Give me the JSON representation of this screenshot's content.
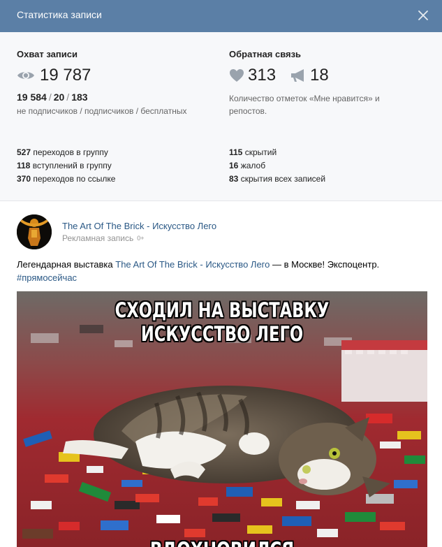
{
  "header": {
    "title": "Статистика записи",
    "close_icon": "close-icon"
  },
  "reach": {
    "title": "Охват записи",
    "icon": "eye-icon",
    "total": "19 787",
    "non_subscribers": "19 584",
    "subscribers": "20",
    "free": "183",
    "separator": "/",
    "legend": "не подписчиков / подписчиков / бесплатных"
  },
  "feedback": {
    "title": "Обратная связь",
    "likes_icon": "heart-icon",
    "likes": "313",
    "reposts_icon": "megaphone-icon",
    "reposts": "18",
    "description": "Количество отметок «Мне нравится» и репостов."
  },
  "actions_left": [
    {
      "count": "527",
      "label": "переходов в группу"
    },
    {
      "count": "118",
      "label": "вступлений в группу"
    },
    {
      "count": "370",
      "label": "переходов по ссылке"
    }
  ],
  "actions_right": [
    {
      "count": "115",
      "label": "скрытий"
    },
    {
      "count": "16",
      "label": "жалоб"
    },
    {
      "count": "83",
      "label": "скрытия всех записей"
    }
  ],
  "post": {
    "author": "The Art Of The Brick - Искусство Лего",
    "meta": "Рекламная запись",
    "age_rating": "0+",
    "text_before": "Легендарная выставка ",
    "text_link": "The Art Of The Brick - Искусство Лего",
    "text_after": " — в Москве! Экспоцентр.",
    "hashtag": "#прямосейчас",
    "image_caption_top": "СХОДИЛ НА ВЫСТАВКУ ИСКУССТВО ЛЕГО",
    "image_caption_bottom": "ВДОХНОВИЛСЯ"
  },
  "colors": {
    "header_bg": "#5b7fa6",
    "stats_bg": "#f7f8fa",
    "link": "#2a5885",
    "muted": "#656565",
    "icon": "#9aa3ad"
  }
}
